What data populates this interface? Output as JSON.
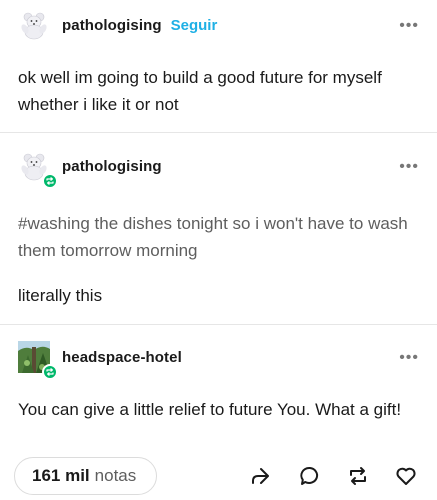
{
  "post1": {
    "username": "pathologising",
    "follow_label": "Seguir",
    "more_label": "•••",
    "text": "ok well im going to build a good future for myself whether i like it or not"
  },
  "post2": {
    "username": "pathologising",
    "more_label": "•••",
    "tag_line": "#washing the dishes tonight so i won't have to wash them tomorrow morning",
    "comment": "literally this"
  },
  "post3": {
    "username": "headspace-hotel",
    "more_label": "•••",
    "text": "You can give a little relief to future You. What a gift!"
  },
  "footer": {
    "notes_count": "161 mil",
    "notes_label": "notas"
  },
  "icons": {
    "share": "share-icon",
    "reply": "reply-icon",
    "reblog": "reblog-icon",
    "like": "heart-icon"
  },
  "colors": {
    "follow_accent": "#1fb0e5",
    "reblog_green": "#00b86b"
  }
}
